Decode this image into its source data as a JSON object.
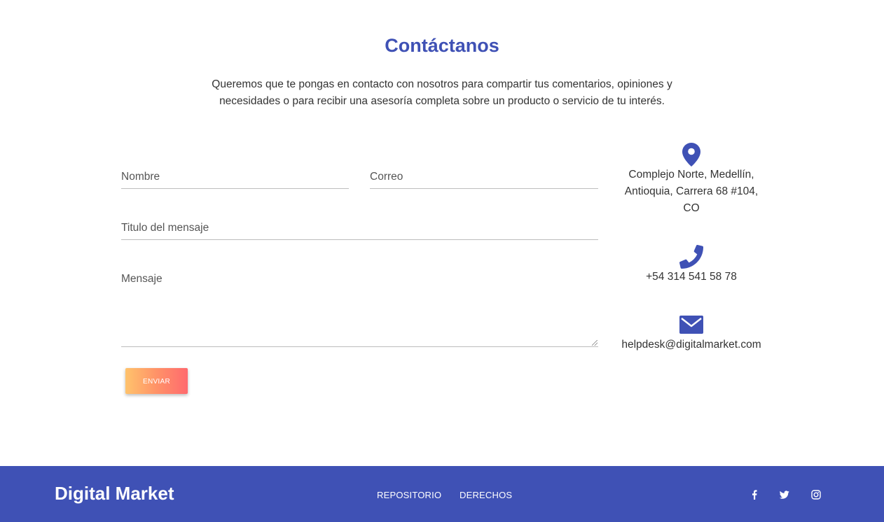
{
  "contact": {
    "title": "Contáctanos",
    "intro_line1": "Queremos que te pongas en contacto con nosotros para compartir tus comentarios, opiniones y",
    "intro_line2": "necesidades o para recibir una asesoría completa sobre un producto o servicio de tu interés."
  },
  "form": {
    "nombre_label": "Nombre",
    "correo_label": "Correo",
    "titulo_label": "Titulo del mensaje",
    "mensaje_label": "Mensaje",
    "submit_label": "ENVIAR"
  },
  "info": {
    "address_line1": "Complejo Norte, Medellín,",
    "address_line2": "Antioquia, Carrera 68 #104,",
    "address_line3": "CO",
    "phone": "+54 314 541 58 78",
    "email": "helpdesk@digitalmarket.com",
    "icons": [
      "map-marker-icon",
      "phone-icon",
      "envelope-icon"
    ]
  },
  "footer": {
    "brand": "Digital Market",
    "links": [
      "REPOSITORIO",
      "DERECHOS"
    ],
    "social_icons": [
      "facebook-icon",
      "twitter-icon",
      "instagram-icon"
    ]
  },
  "colors": {
    "primary": "#3f51b5",
    "button_gradient_start": "#ffc36c",
    "button_gradient_end": "#ff6a6e"
  }
}
